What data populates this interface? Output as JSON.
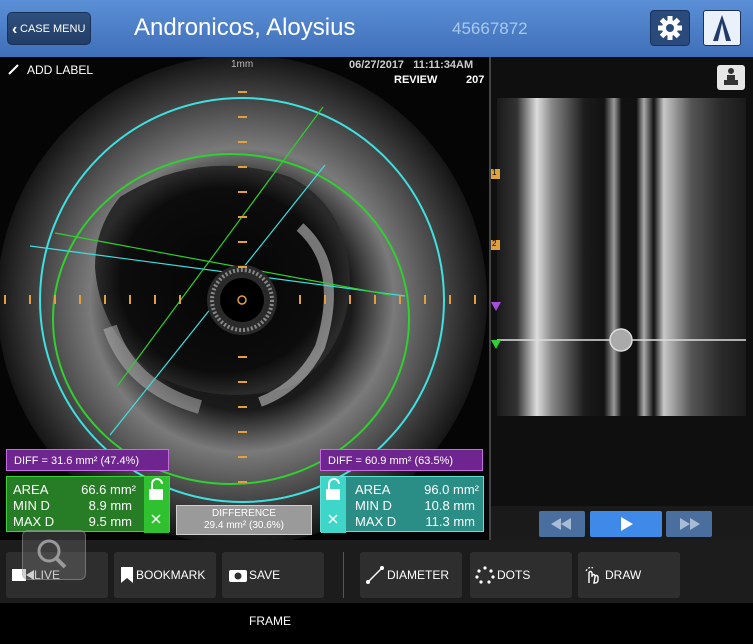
{
  "header": {
    "case_menu_label": "CASE MENU",
    "patient_name": "Andronicos, Aloysius",
    "patient_id": "45667872"
  },
  "ivus": {
    "add_label": "ADD LABEL",
    "scale": "1mm",
    "date": "06/27/2017",
    "time": "11:11:34AM",
    "mode": "REVIEW",
    "frame": "207"
  },
  "left_measure": {
    "diff": "DIFF = 31.6 mm² (47.4%)",
    "area_label": "AREA",
    "area_value": "66.6 mm²",
    "min_label": "MIN D",
    "min_value": "8.9 mm",
    "max_label": "MAX D",
    "max_value": "9.5 mm",
    "color": "#2db52d"
  },
  "right_measure": {
    "diff": "DIFF = 60.9 mm² (63.5%)",
    "area_label": "AREA",
    "area_value": "96.0 mm²",
    "min_label": "MIN D",
    "min_value": "10.8 mm",
    "max_label": "MAX D",
    "max_value": "11.3 mm",
    "color": "#3fb6ad"
  },
  "difference": {
    "label": "DIFFERENCE",
    "value": "29.4 mm² (30.6%)"
  },
  "longitudinal": {
    "bookmarks": [
      "1",
      "2"
    ]
  },
  "toolbar": {
    "live": "LIVE",
    "bookmark": "BOOKMARK",
    "save_frame": "SAVE FRAME",
    "diameter": "DIAMETER",
    "dots": "DOTS",
    "draw": "DRAW"
  }
}
